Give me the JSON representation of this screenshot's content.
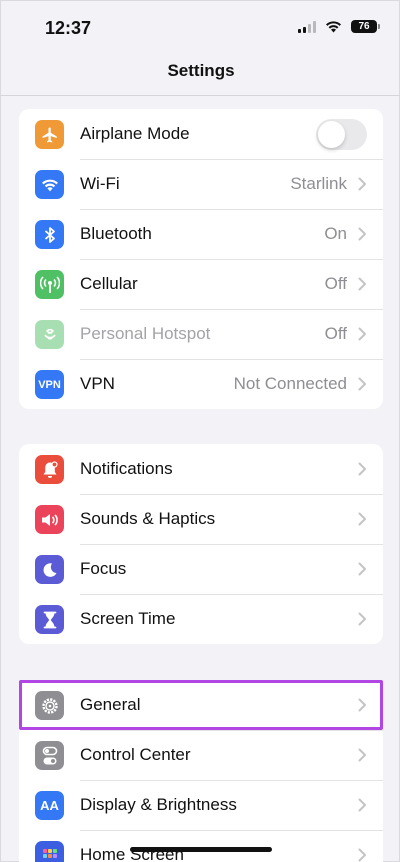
{
  "status_bar": {
    "time": "12:37",
    "battery": "76"
  },
  "nav": {
    "title": "Settings"
  },
  "groups": [
    {
      "rows": [
        {
          "label": "Airplane Mode",
          "value": "",
          "icon": "airplane-icon",
          "color": "#f09a37",
          "toggle": false
        },
        {
          "label": "Wi-Fi",
          "value": "Starlink",
          "icon": "wifi-icon",
          "color": "#3478f6"
        },
        {
          "label": "Bluetooth",
          "value": "On",
          "icon": "bluetooth-icon",
          "color": "#3478f6"
        },
        {
          "label": "Cellular",
          "value": "Off",
          "icon": "antenna-icon",
          "color": "#4fc164"
        },
        {
          "label": "Personal Hotspot",
          "value": "Off",
          "icon": "hotspot-icon",
          "color": "#a8dfb2",
          "disabled": true
        },
        {
          "label": "VPN",
          "value": "Not Connected",
          "icon": "vpn-icon",
          "icon_text": "VPN",
          "color": "#3478f6"
        }
      ]
    },
    {
      "rows": [
        {
          "label": "Notifications",
          "value": "",
          "icon": "bell-icon",
          "color": "#eb4d3d"
        },
        {
          "label": "Sounds & Haptics",
          "value": "",
          "icon": "speaker-icon",
          "color": "#eb445a"
        },
        {
          "label": "Focus",
          "value": "",
          "icon": "moon-icon",
          "color": "#5b5bd6"
        },
        {
          "label": "Screen Time",
          "value": "",
          "icon": "hourglass-icon",
          "color": "#5b5bd6"
        }
      ]
    },
    {
      "rows": [
        {
          "label": "General",
          "value": "",
          "icon": "gear-icon",
          "color": "#8e8e93"
        },
        {
          "label": "Control Center",
          "value": "",
          "icon": "switches-icon",
          "color": "#8e8e93"
        },
        {
          "label": "Display & Brightness",
          "value": "",
          "icon": "text-size-icon",
          "icon_text": "AA",
          "color": "#3478f6"
        },
        {
          "label": "Home Screen",
          "value": "",
          "icon": "home-grid-icon",
          "color": "#3b5fe0"
        }
      ]
    }
  ],
  "colors": {
    "accent_highlight": "#b246e5",
    "background": "#f2f2f7"
  }
}
